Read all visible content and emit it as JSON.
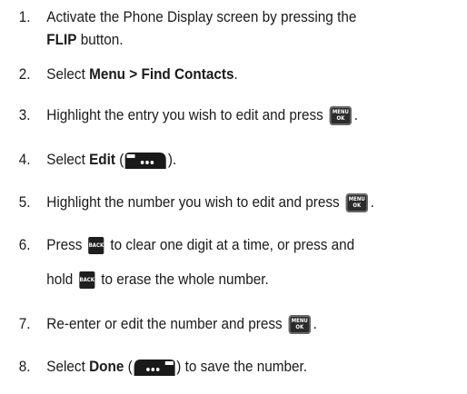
{
  "steps": [
    {
      "num": "1.",
      "line1_pre": "Activate the Phone Display screen by pressing the",
      "line2_bold": "FLIP",
      "line2_post": " button."
    },
    {
      "num": "2.",
      "pre": "Select ",
      "bold": "Menu > Find Contacts",
      "post": "."
    },
    {
      "num": "3.",
      "pre": "Highlight the entry you wish to edit and press ",
      "post": "."
    },
    {
      "num": "4.",
      "pre": "Select ",
      "bold": "Edit",
      "post1": " (",
      "post2": ")."
    },
    {
      "num": "5.",
      "pre": "Highlight the number you wish to edit and press ",
      "post": "."
    },
    {
      "num": "6.",
      "line1_pre": "Press ",
      "line1_post": " to clear one digit at a time, or press and",
      "line2_pre": "hold ",
      "line2_post": " to erase the whole number."
    },
    {
      "num": "7.",
      "pre": "Re-enter or edit the number and press ",
      "post": "."
    },
    {
      "num": "8.",
      "pre": "Select ",
      "bold": "Done",
      "post1": " (",
      "post2": ") to save the number."
    }
  ],
  "keys": {
    "menu_top": "MENU",
    "menu_bottom": "OK",
    "back": "BACK"
  },
  "icons": {
    "menu_ok": "menu-ok-key-icon",
    "back": "back-key-icon",
    "left_soft": "left-softkey-icon",
    "right_soft": "right-softkey-icon"
  }
}
